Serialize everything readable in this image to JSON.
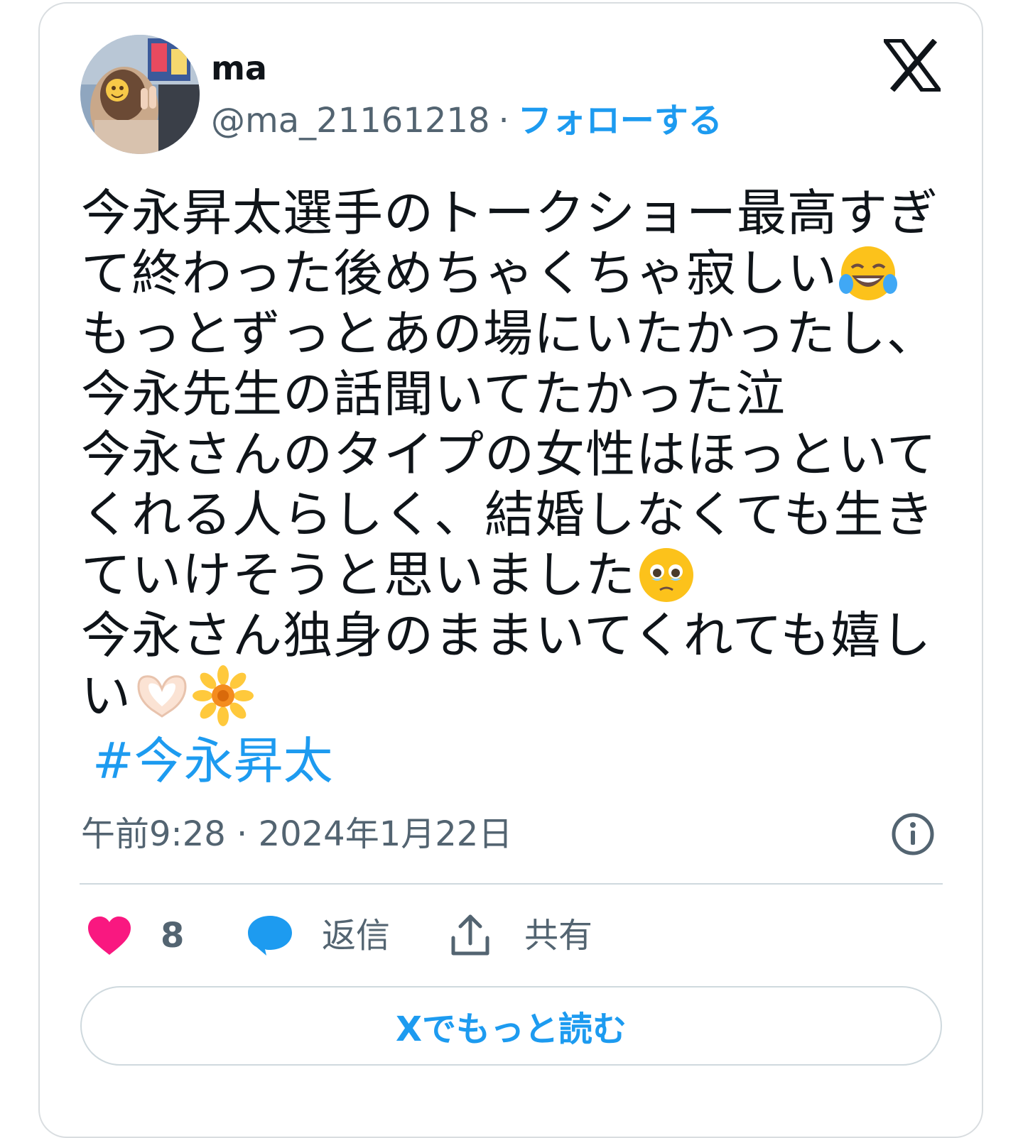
{
  "author": {
    "display_name": "ma",
    "handle": "@ma_21161218",
    "separator": "·",
    "follow_label": "フォローする"
  },
  "tweet": {
    "lines": [
      "今永昇太選手のトークショー最高すぎ",
      "て終わった後めちゃくちゃ寂しい",
      "もっとずっとあの場にいたかったし、",
      "今永先生の話聞いてたかった泣",
      "今永さんのタイプの女性はほっといて",
      "くれる人らしく、結婚しなくても生き",
      "ていけそうと思いました",
      "今永さん独身のままいてくれても嬉し",
      "い"
    ],
    "hashtag": "#今永昇太"
  },
  "meta": {
    "timestamp": "午前9:28 · 2024年1月22日"
  },
  "actions": {
    "likes_count": "8",
    "reply_label": "返信",
    "share_label": "共有"
  },
  "read_more_label": "Xでもっと読む",
  "icons": {
    "brand": "x-logo-icon",
    "info": "info-icon",
    "like": "heart-icon",
    "reply": "speech-bubble-icon",
    "share": "share-upload-icon",
    "emoji_1": "face-with-tears-of-joy",
    "emoji_2": "face-holding-back-tears",
    "emoji_3": "heart-hands",
    "emoji_4": "blossom"
  },
  "colors": {
    "accent": "#1d9bf0",
    "secondary_text": "#536471",
    "like": "#f91880",
    "border": "#cfd9de"
  }
}
